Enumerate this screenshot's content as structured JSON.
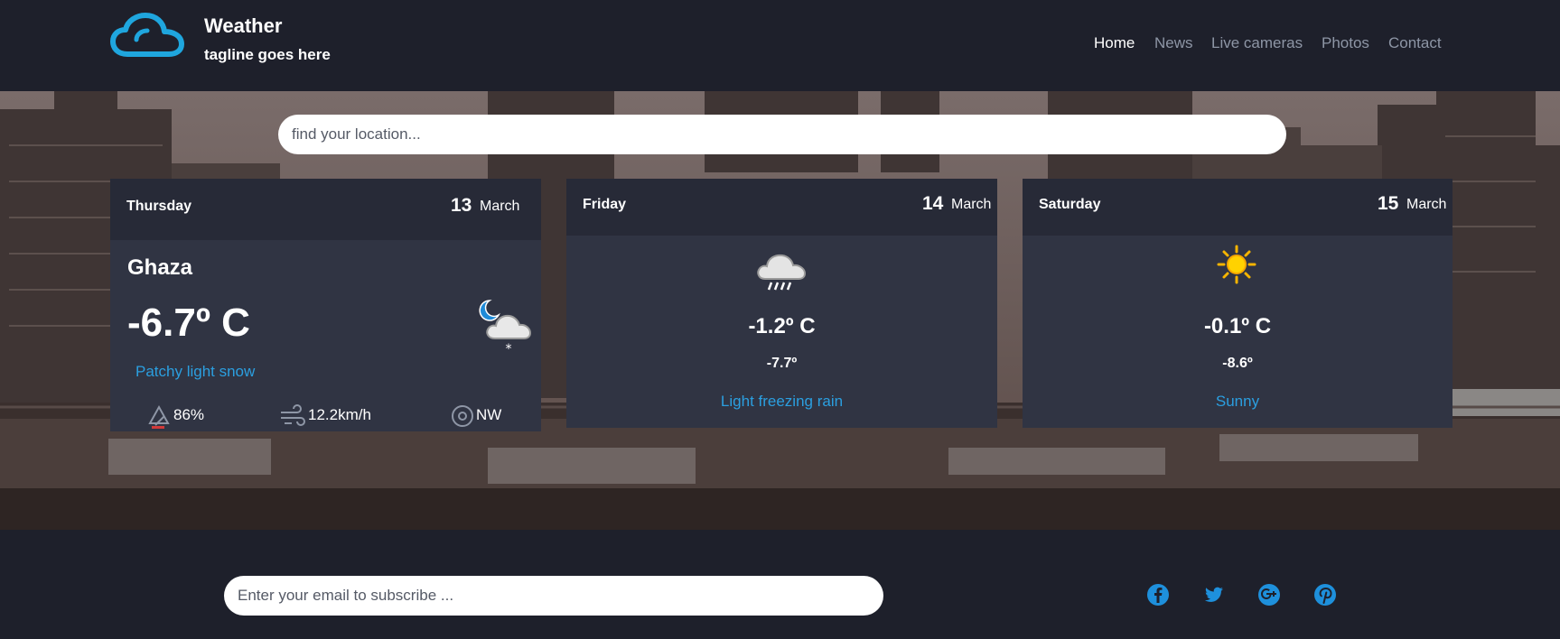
{
  "header": {
    "title": "Weather",
    "tagline": "tagline goes here",
    "logo_icon": "cloud-icon",
    "nav": [
      {
        "label": "Home",
        "active": true
      },
      {
        "label": "News",
        "active": false
      },
      {
        "label": "Live cameras",
        "active": false
      },
      {
        "label": "Photos",
        "active": false
      },
      {
        "label": "Contact",
        "active": false
      }
    ]
  },
  "search": {
    "placeholder": "find your location..."
  },
  "today": {
    "day": "Thursday",
    "date_num": "13",
    "month": "March",
    "city": "Ghaza",
    "temp": "-6.7º C",
    "condition": "Patchy light snow",
    "icon": "night-snow-icon",
    "humidity": "86%",
    "wind_speed": "12.2km/h",
    "wind_dir": "NW"
  },
  "forecast": [
    {
      "day": "Friday",
      "date_num": "14",
      "month": "March",
      "temp": "-1.2º C",
      "low": "-7.7º",
      "condition": "Light freezing rain",
      "icon": "freezing-rain-icon"
    },
    {
      "day": "Saturday",
      "date_num": "15",
      "month": "March",
      "temp": "-0.1º C",
      "low": "-8.6º",
      "condition": "Sunny",
      "icon": "sun-icon"
    }
  ],
  "footer": {
    "email_placeholder": "Enter your email to subscribe ...",
    "social": [
      "facebook-icon",
      "twitter-icon",
      "google-plus-icon",
      "pinterest-icon"
    ]
  },
  "colors": {
    "accent": "#2b9fe0",
    "bg": "#1e202b",
    "card": "#303443",
    "card_head": "#272a37"
  }
}
